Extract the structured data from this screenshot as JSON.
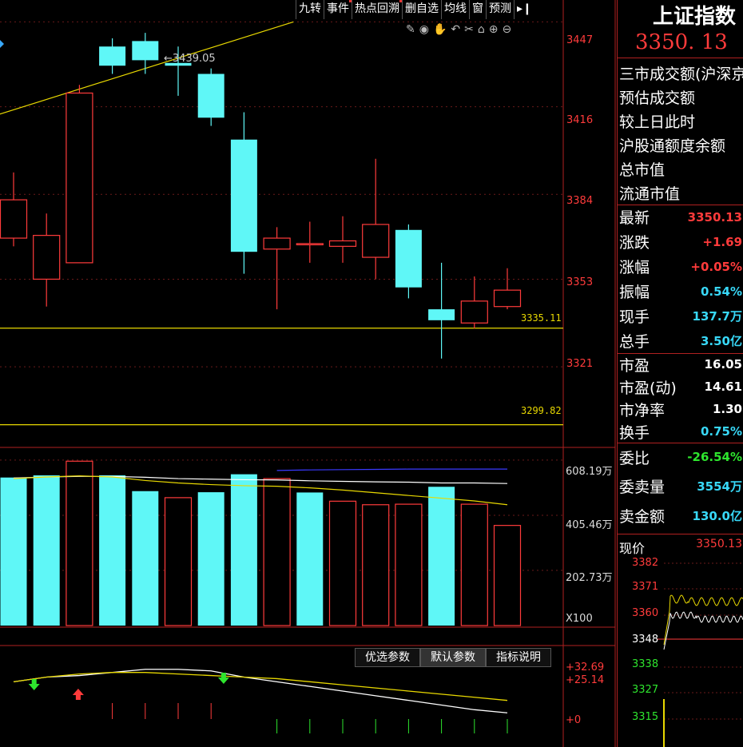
{
  "toolbar": {
    "items": [
      "九转",
      "事件",
      "热点回溯",
      "删自选",
      "均线",
      "窗",
      "预测"
    ],
    "expand_icon": "panel-expand-icon"
  },
  "draw_tools": [
    "pencil-icon",
    "eye-icon",
    "hand-icon",
    "undo-icon",
    "scissors-icon",
    "lock-icon",
    "zoom-in-icon",
    "zoom-out-icon"
  ],
  "price_axis": {
    "ticks": [
      "3447",
      "3416",
      "3384",
      "3353",
      "3321"
    ]
  },
  "annotations": {
    "high_label": "3439.05",
    "hline_upper": "3335.11",
    "hline_lower": "3299.82"
  },
  "chart_data": [
    {
      "type": "candlestick",
      "ylim": [
        3293,
        3455
      ],
      "candles": [
        {
          "open": 3368,
          "close": 3382,
          "high": 3392,
          "low": 3365
        },
        {
          "open": 3353,
          "close": 3369,
          "high": 3377,
          "low": 3343
        },
        {
          "open": 3359,
          "close": 3421,
          "high": 3424,
          "low": 3359
        },
        {
          "open": 3438,
          "close": 3431,
          "high": 3441,
          "low": 3428
        },
        {
          "open": 3440,
          "close": 3433,
          "high": 3443,
          "low": 3428
        },
        {
          "open": 3432,
          "close": 3431,
          "high": 3438,
          "low": 3420
        },
        {
          "open": 3428,
          "close": 3412,
          "high": 3430,
          "low": 3409
        },
        {
          "open": 3404,
          "close": 3363,
          "high": 3414,
          "low": 3355
        },
        {
          "open": 3364,
          "close": 3368,
          "high": 3372,
          "low": 3342
        },
        {
          "open": 3366,
          "close": 3366,
          "high": 3374,
          "low": 3359
        },
        {
          "open": 3365,
          "close": 3367,
          "high": 3376,
          "low": 3359
        },
        {
          "open": 3361,
          "close": 3373,
          "high": 3397,
          "low": 3353
        },
        {
          "open": 3371,
          "close": 3350,
          "high": 3373,
          "low": 3346
        },
        {
          "open": 3342,
          "close": 3338,
          "high": 3359,
          "low": 3324
        },
        {
          "open": 3337,
          "close": 3345,
          "high": 3354,
          "low": 3335
        },
        {
          "open": 3343,
          "close": 3349,
          "high": 3357,
          "low": 3342
        }
      ],
      "trend_line": {
        "from": {
          "candle": -0.5,
          "value": 3413
        },
        "to": {
          "candle": 8.5,
          "value": 3447
        }
      },
      "horizontal_lines": [
        3335.11,
        3299.82
      ]
    },
    {
      "type": "bar",
      "series": [
        {
          "name": "volume",
          "values": [
            544,
            552,
            604,
            552,
            494,
            470,
            490,
            556,
            540,
            489,
            457,
            444,
            446,
            510,
            446,
            368
          ],
          "up": [
            false,
            false,
            true,
            false,
            false,
            true,
            false,
            false,
            true,
            false,
            true,
            true,
            true,
            false,
            true,
            true
          ]
        }
      ],
      "ma_lines": [
        {
          "color": "#3a3aff",
          "values": [
            null,
            null,
            null,
            null,
            null,
            null,
            null,
            null,
            570,
            572,
            573,
            574,
            575,
            575,
            575,
            575
          ]
        },
        {
          "color": "#ffffff",
          "values": [
            542,
            546,
            548,
            548,
            545,
            540,
            538,
            536,
            535,
            532,
            530,
            528,
            527,
            524,
            524,
            522
          ]
        },
        {
          "color": "#e8d800",
          "values": [
            540,
            546,
            550,
            546,
            533,
            524,
            518,
            514,
            512,
            506,
            498,
            488,
            478,
            468,
            458,
            444
          ]
        }
      ],
      "ylim": [
        0,
        640
      ]
    },
    {
      "type": "line",
      "series": [
        {
          "name": "white",
          "values": [
            22,
            25,
            26,
            28,
            30,
            30,
            29,
            25,
            22,
            19,
            16,
            13,
            10,
            7,
            4,
            2
          ]
        },
        {
          "name": "yellow",
          "values": [
            22,
            25,
            27,
            28,
            28,
            27,
            26,
            25,
            24,
            22,
            20,
            18,
            16,
            14,
            12,
            10
          ]
        }
      ],
      "ylim": [
        -2,
        34
      ]
    }
  ],
  "volume_axis": {
    "ticks": [
      "608.19万",
      "405.46万",
      "202.73万"
    ],
    "unit": "X100"
  },
  "indicator": {
    "buttons": [
      "优选参数",
      "默认参数",
      "指标说明"
    ],
    "ticks": [
      "+32.69",
      "+25.14",
      "+0"
    ]
  },
  "quote_panel": {
    "title": "上证指数",
    "price": "3350. 13",
    "info_rows": [
      "三市成交额(沪深京",
      "预估成交额",
      "较上日此时",
      "沪股通额度余额",
      "总市值",
      "流通市值"
    ],
    "stats": [
      {
        "label": "最新",
        "value": "3350.13",
        "color": "red"
      },
      {
        "label": "涨跌",
        "value": "+1.69",
        "color": "red"
      },
      {
        "label": "涨幅",
        "value": "+0.05%",
        "color": "red"
      },
      {
        "label": "振幅",
        "value": "0.54%",
        "color": "cyan"
      },
      {
        "label": "现手",
        "value": "137.7万",
        "color": "cyan"
      },
      {
        "label": "总手",
        "value": "3.50亿",
        "color": "cyan"
      },
      {
        "label": "市盈",
        "value": "16.05",
        "color": "white"
      },
      {
        "label": "市盈(动)",
        "value": "14.61",
        "color": "white"
      },
      {
        "label": "市净率",
        "value": "1.30",
        "color": "white"
      },
      {
        "label": "换手",
        "value": "0.75%",
        "color": "cyan"
      },
      {
        "label": "委比",
        "value": "-26.54%",
        "color": "green"
      },
      {
        "label": "委卖量",
        "value": "3554万",
        "color": "cyan"
      },
      {
        "label": "卖金额",
        "value": "130.0亿",
        "color": "cyan"
      }
    ],
    "current_price_label": "现价",
    "current_price_value": "3350.13",
    "mini_ticks": [
      "3382",
      "3371",
      "3360",
      "3348",
      "3338",
      "3327",
      "3315"
    ]
  }
}
